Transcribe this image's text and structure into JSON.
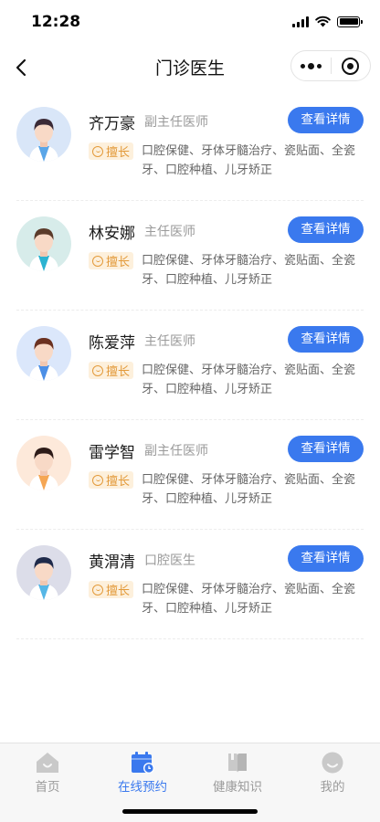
{
  "status_bar": {
    "time": "12:28"
  },
  "nav": {
    "title": "门诊医生"
  },
  "doctors": [
    {
      "name": "齐万豪",
      "title": "副主任医师",
      "tag": "擅长",
      "specialty": "口腔保健、牙体牙髓治疗、瓷贴面、全瓷牙、口腔种植、儿牙矫正",
      "button": "查看详情"
    },
    {
      "name": "林安娜",
      "title": "主任医师",
      "tag": "擅长",
      "specialty": "口腔保健、牙体牙髓治疗、瓷贴面、全瓷牙、口腔种植、儿牙矫正",
      "button": "查看详情"
    },
    {
      "name": "陈爱萍",
      "title": "主任医师",
      "tag": "擅长",
      "specialty": "口腔保健、牙体牙髓治疗、瓷贴面、全瓷牙、口腔种植、儿牙矫正",
      "button": "查看详情"
    },
    {
      "name": "雷学智",
      "title": "副主任医师",
      "tag": "擅长",
      "specialty": "口腔保健、牙体牙髓治疗、瓷贴面、全瓷牙、口腔种植、儿牙矫正",
      "button": "查看详情"
    },
    {
      "name": "黄渭清",
      "title": "口腔医生",
      "tag": "擅长",
      "specialty": "口腔保健、牙体牙髓治疗、瓷贴面、全瓷牙、口腔种植、儿牙矫正",
      "button": "查看详情"
    }
  ],
  "tabbar": {
    "items": [
      {
        "label": "首页",
        "icon": "home-icon",
        "active": false
      },
      {
        "label": "在线预约",
        "icon": "calendar-icon",
        "active": true
      },
      {
        "label": "健康知识",
        "icon": "book-icon",
        "active": false
      },
      {
        "label": "我的",
        "icon": "profile-icon",
        "active": false
      }
    ]
  },
  "colors": {
    "accent": "#3a79ee",
    "tag_text": "#e39a3a",
    "tag_bg": "#fdf0dc",
    "avatar_bg": [
      "#d9e6f8",
      "#d7ecea",
      "#dbe7fb",
      "#fde9da",
      "#dcdde9"
    ],
    "hair": [
      "#3b2a36",
      "#5b3b2a",
      "#6b3120",
      "#2d1b18",
      "#1f2a4a"
    ],
    "shirt": [
      "#5aa6e8",
      "#2cb3d1",
      "#4c8fe6",
      "#f5a654",
      "#56b6e6"
    ]
  }
}
